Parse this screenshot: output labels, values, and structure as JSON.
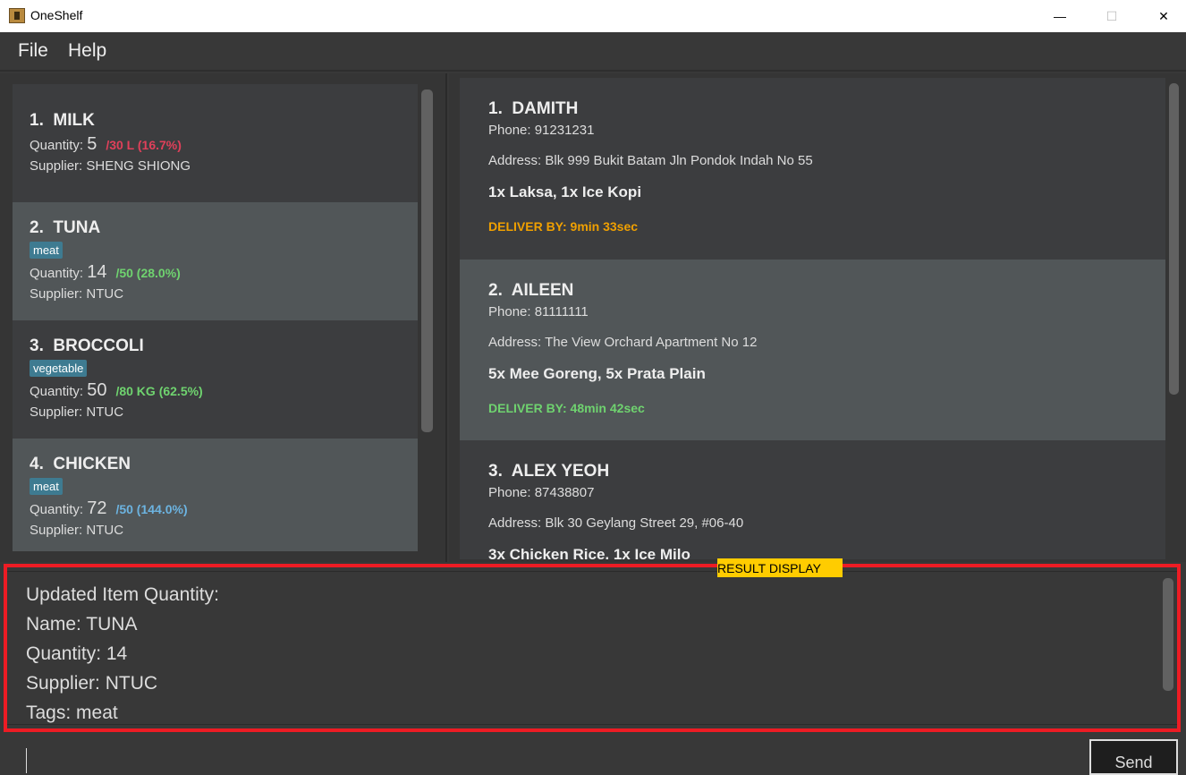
{
  "window": {
    "title": "OneShelf",
    "minimize": "—",
    "maximize": "☐",
    "close": "✕"
  },
  "menu": {
    "file": "File",
    "help": "Help"
  },
  "items": [
    {
      "index": "1.",
      "name": "MILK",
      "tag": null,
      "qty_label": "Quantity:",
      "qty": "5",
      "fraction": "/30 L (16.7%)",
      "fraction_color": "#e0405a",
      "supplier": "Supplier: SHENG SHIONG"
    },
    {
      "index": "2.",
      "name": "TUNA",
      "tag": "meat",
      "qty_label": "Quantity:",
      "qty": "14",
      "fraction": "/50 (28.0%)",
      "fraction_color": "#6fd36f",
      "supplier": "Supplier: NTUC"
    },
    {
      "index": "3.",
      "name": "BROCCOLI",
      "tag": "vegetable",
      "qty_label": "Quantity:",
      "qty": "50",
      "fraction": "/80 KG (62.5%)",
      "fraction_color": "#6fd36f",
      "supplier": "Supplier: NTUC"
    },
    {
      "index": "4.",
      "name": "CHICKEN",
      "tag": "meat",
      "qty_label": "Quantity:",
      "qty": "72",
      "fraction": "/50 (144.0%)",
      "fraction_color": "#6cb3e0",
      "supplier": "Supplier: NTUC"
    }
  ],
  "orders": [
    {
      "index": "1.",
      "name": "DAMITH",
      "phone": "Phone: 91231231",
      "address": "Address: Blk 999 Bukit Batam Jln Pondok Indah No 55",
      "items": "1x Laksa, 1x Ice Kopi",
      "deliver": "DELIVER BY: 9min 33sec",
      "deliver_color": "#f0a000"
    },
    {
      "index": "2.",
      "name": "AILEEN",
      "phone": "Phone: 81111111",
      "address": "Address: The View Orchard Apartment No 12",
      "items": "5x Mee Goreng, 5x Prata Plain",
      "deliver": "DELIVER BY: 48min 42sec",
      "deliver_color": "#6fd36f"
    },
    {
      "index": "3.",
      "name": "ALEX YEOH",
      "phone": "Phone: 87438807",
      "address": "Address: Blk 30 Geylang Street 29, #06-40",
      "items": "3x Chicken Rice, 1x Ice Milo"
    }
  ],
  "result": {
    "label": "RESULT DISPLAY",
    "lines": [
      "Updated Item Quantity:",
      "Name: TUNA",
      "Quantity: 14",
      "Supplier: NTUC",
      "Tags: meat"
    ]
  },
  "command": {
    "value": "",
    "send": "Send"
  }
}
